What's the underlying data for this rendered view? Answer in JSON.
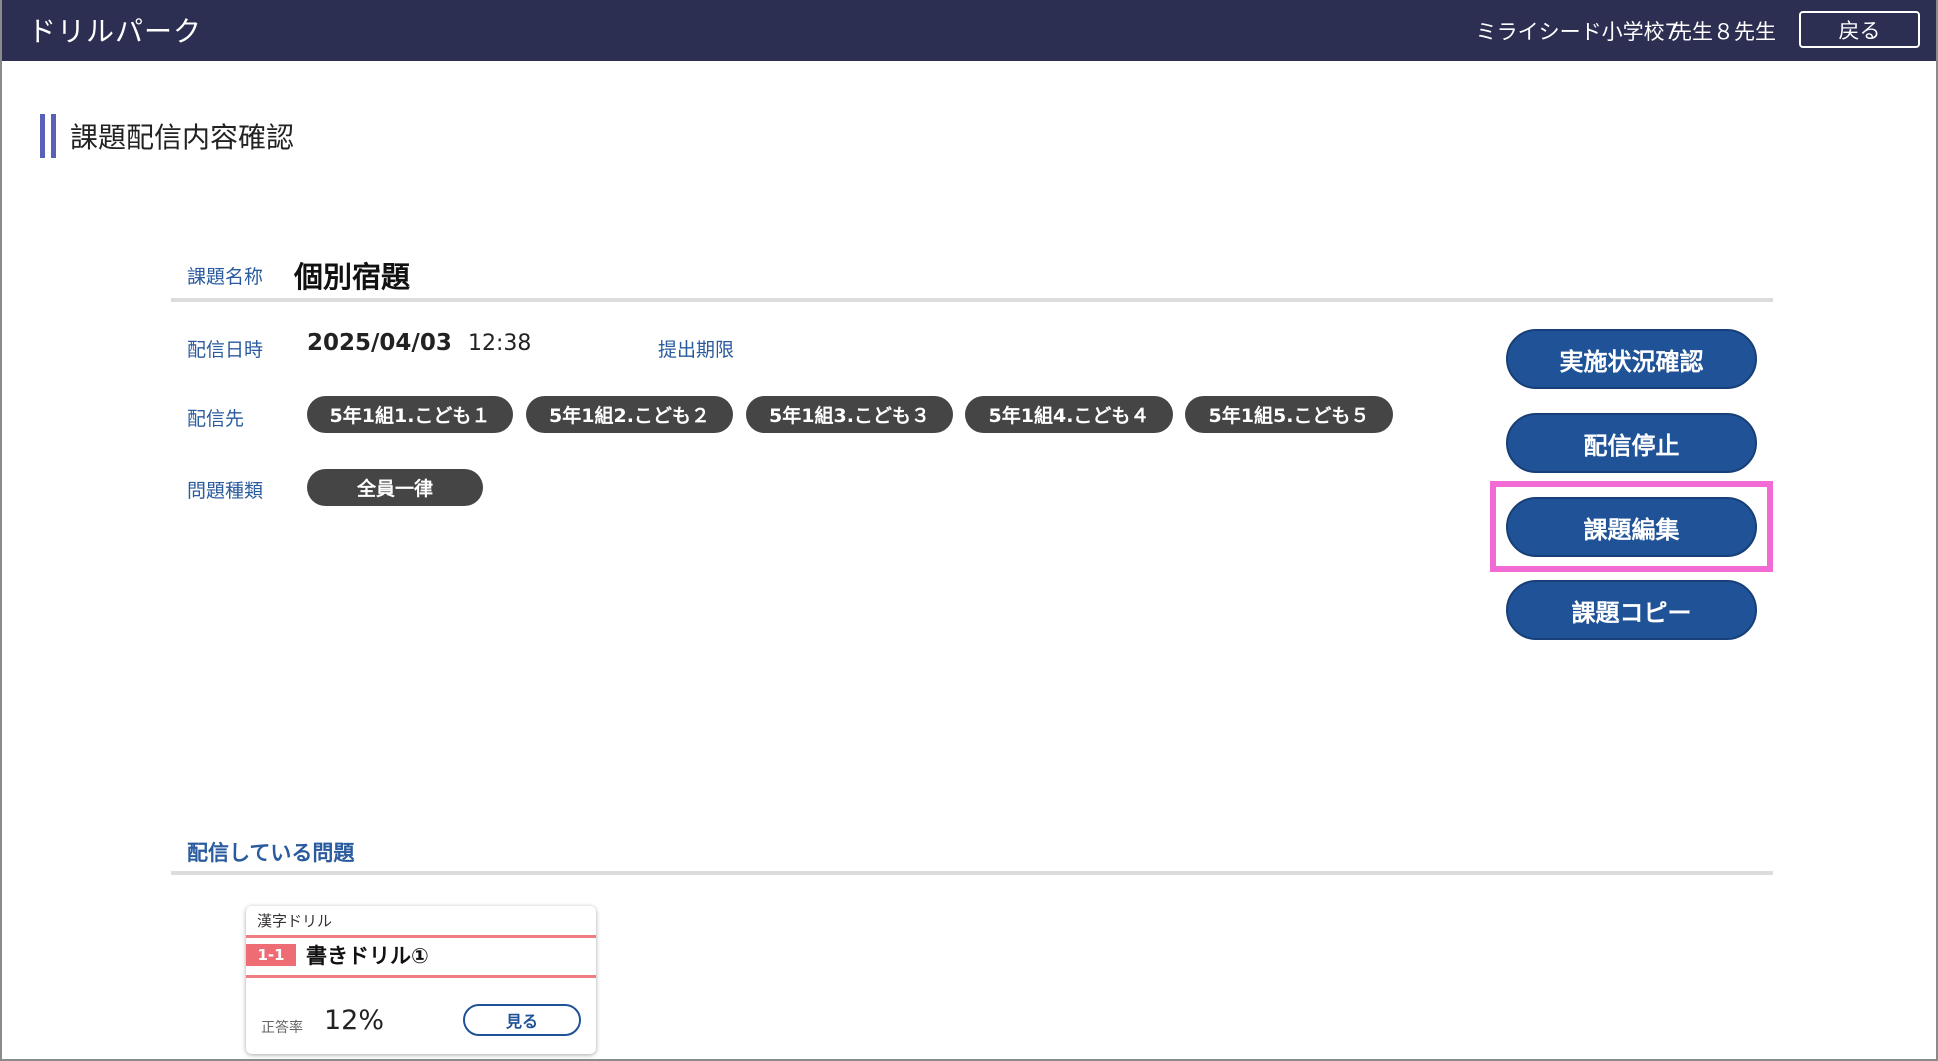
{
  "header": {
    "app_title": "ドリルパーク",
    "school": "ミライシード小学校7",
    "teacher": "先生８先生",
    "back_label": "戻る"
  },
  "page": {
    "title": "課題配信内容確認"
  },
  "task": {
    "name_label": "課題名称",
    "name": "個別宿題",
    "delivery_label": "配信日時",
    "delivery_date": "2025/04/03",
    "delivery_time": "12:38",
    "deadline_label": "提出期限",
    "recipients_label": "配信先",
    "recipients": [
      "5年1組1.こども１",
      "5年1組2.こども２",
      "5年1組3.こども３",
      "5年1組4.こども４",
      "5年1組5.こども５"
    ],
    "problem_type_label": "問題種類",
    "problem_type": "全員一律"
  },
  "actions": {
    "status": "実施状況確認",
    "stop": "配信停止",
    "edit": "課題編集",
    "copy": "課題コピー"
  },
  "problems": {
    "section_title": "配信している問題",
    "items": [
      {
        "category": "漢字ドリル",
        "number": "1-1",
        "name": "書きドリル①",
        "rate_label": "正答率",
        "rate": "12%",
        "view_label": "見る"
      }
    ]
  },
  "colors": {
    "header_bg": "#2c2e52",
    "button_blue": "#1f5296",
    "chip_bg": "#454545",
    "highlight": "#f26bd4",
    "accent_red": "#ee6c74"
  }
}
